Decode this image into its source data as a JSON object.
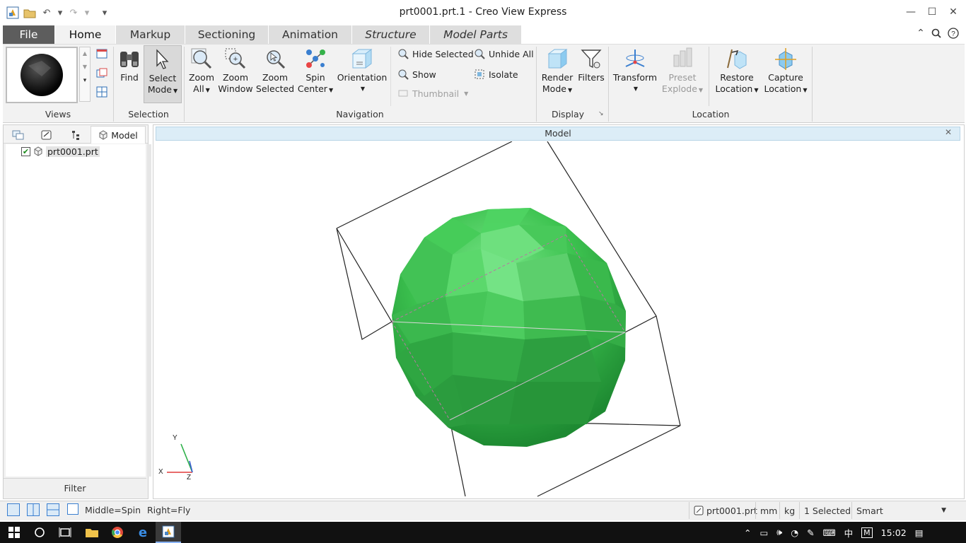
{
  "window": {
    "title": "prt0001.prt.1 - Creo View Express"
  },
  "tabs": [
    {
      "label": "File"
    },
    {
      "label": "Home"
    },
    {
      "label": "Markup"
    },
    {
      "label": "Sectioning"
    },
    {
      "label": "Animation"
    },
    {
      "label": "Structure"
    },
    {
      "label": "Model Parts"
    }
  ],
  "ribbon": {
    "groups": {
      "views": "Views",
      "selection": "Selection",
      "navigation": "Navigation",
      "display": "Display",
      "location": "Location"
    },
    "find": "Find",
    "select_mode": [
      "Select",
      "Mode"
    ],
    "zoom_all": [
      "Zoom",
      "All"
    ],
    "zoom_window": [
      "Zoom",
      "Window"
    ],
    "zoom_selected": [
      "Zoom",
      "Selected"
    ],
    "spin_center": [
      "Spin",
      "Center"
    ],
    "orientation": "Orientation",
    "hide_selected": "Hide Selected",
    "unhide_all": "Unhide All",
    "show": "Show",
    "isolate": "Isolate",
    "thumbnail": "Thumbnail",
    "render_mode": [
      "Render",
      "Mode"
    ],
    "filters": "Filters",
    "transform": "Transform",
    "preset_explode": [
      "Preset",
      "Explode"
    ],
    "restore_location": [
      "Restore",
      "Location"
    ],
    "capture_location": [
      "Capture",
      "Location"
    ]
  },
  "left_panel": {
    "model_tab": "Model",
    "tree_item": "prt0001.prt",
    "tree_item_checked": true,
    "filter_label": "Filter"
  },
  "viewport": {
    "title": "Model",
    "triad": {
      "x": "X",
      "y": "Y",
      "z": "Z"
    },
    "model_color": "#3cc24f"
  },
  "status": {
    "mouse_middle": "Middle=Spin",
    "mouse_right": "Right=Fly",
    "file": "prt0001.prt",
    "length_unit": "mm",
    "mass_unit": "kg",
    "selected": "1 Selected",
    "smart": "Smart"
  },
  "taskbar": {
    "ime": "中",
    "ime_mode": "M",
    "time": "15:02"
  }
}
